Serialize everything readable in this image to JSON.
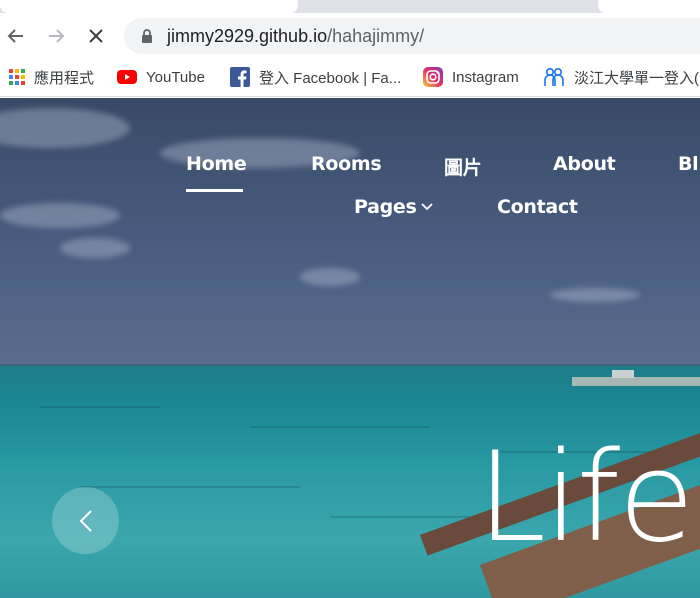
{
  "browser": {
    "url_host": "jimmy2929.github.io",
    "url_path": "/hahajimmy/"
  },
  "bookmarks": [
    {
      "label": "應用程式",
      "icon": "apps-grid-icon"
    },
    {
      "label": "YouTube",
      "icon": "youtube-icon"
    },
    {
      "label": "登入 Facebook | Fa...",
      "icon": "facebook-icon"
    },
    {
      "label": "Instagram",
      "icon": "instagram-icon"
    },
    {
      "label": "淡江大學單一登入(",
      "icon": "tku-icon"
    }
  ],
  "site_nav": {
    "home": "Home",
    "rooms": "Rooms",
    "pictures": "圖片",
    "about": "About",
    "blog": "Bl",
    "pages": "Pages",
    "contact": "Contact"
  },
  "hero": {
    "title": "Life"
  },
  "colors": {
    "sky": "#425677",
    "sea": "#2a9aa3",
    "nav_text": "#ffffff"
  }
}
